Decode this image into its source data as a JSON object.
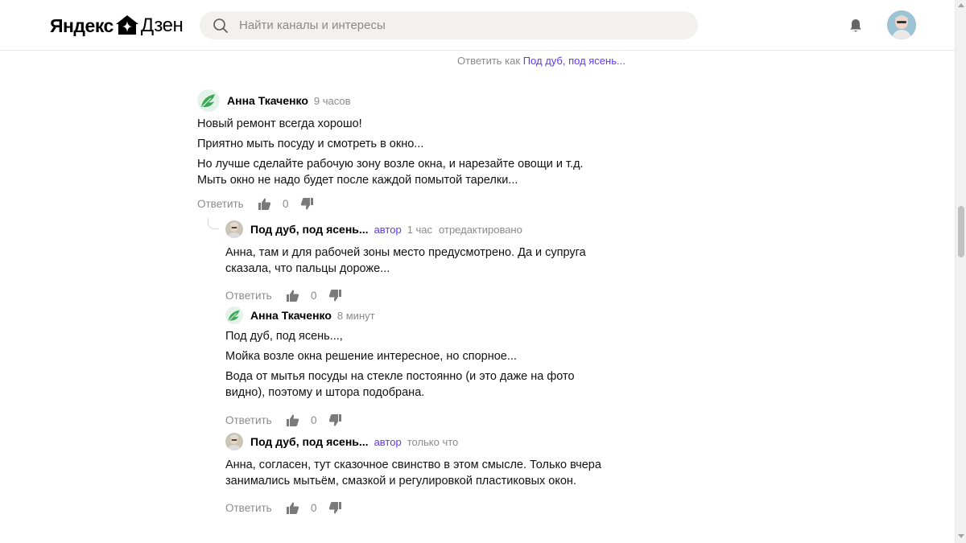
{
  "header": {
    "logo_word1": "Яндекс",
    "logo_word2": "Дзен",
    "search_placeholder": "Найти каналы и интересы",
    "notification_icon": "bell-icon",
    "avatar_icon": "user-avatar"
  },
  "reply_as": {
    "prefix": "Ответить как",
    "name": "Под дуб, под ясень..."
  },
  "colors": {
    "accent": "#6236ff",
    "muted": "#8a8a8a",
    "search_bg": "#f2f1ee"
  },
  "comments": [
    {
      "author": "Анна Ткаченко",
      "time": "9 часов",
      "paragraphs": [
        "Новый ремонт всегда хорошо!",
        "Приятно мыть посуду и смотреть в окно...",
        "Но лучше сделайте рабочую зону возле окна, и нарезайте овощи и т.д. Мыть окно не надо будет после каждой помытой тарелки..."
      ],
      "reply_label": "Ответить",
      "likes": "0"
    },
    {
      "author": "Под дуб, под ясень...",
      "author_badge": "автор",
      "time": "1 час",
      "edited": "отредактировано",
      "paragraphs": [
        "Анна, там и для рабочей зоны место предусмотрено. Да и супруга сказала, что пальцы дороже..."
      ],
      "reply_label": "Ответить",
      "likes": "0"
    },
    {
      "author": "Анна Ткаченко",
      "time": "8 минут",
      "paragraphs": [
        "Под дуб, под ясень...,",
        "Мойка возле окна решение интересное, но спорное...",
        "Вода от мытья посуды на стекле постоянно (и это даже на фото видно), поэтому и штора подобрана."
      ],
      "reply_label": "Ответить",
      "likes": "0"
    },
    {
      "author": "Под дуб, под ясень...",
      "author_badge": "автор",
      "time": "только что",
      "paragraphs": [
        "Анна, согласен, тут сказочное свинство в этом смысле. Только вчера занимались мытьём, смазкой и регулировкой пластиковых окон."
      ],
      "reply_label": "Ответить",
      "likes": "0"
    }
  ]
}
